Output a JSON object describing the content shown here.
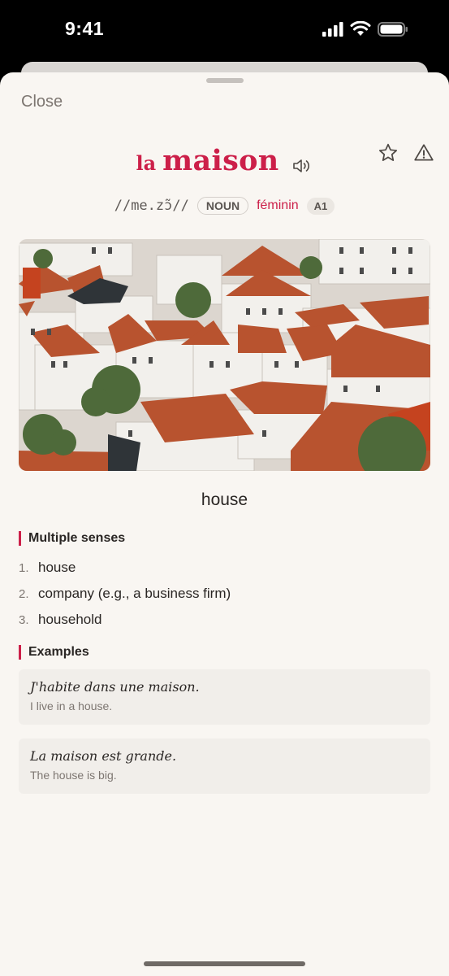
{
  "status_bar": {
    "time": "9:41"
  },
  "sheet": {
    "close_label": "Close"
  },
  "entry": {
    "article": "la",
    "headword": "maison",
    "ipa": "//me.zɔ̃//",
    "part_of_speech": "NOUN",
    "gender": "féminin",
    "level": "A1",
    "translation": "house"
  },
  "senses_section": {
    "title": "Multiple senses",
    "items": [
      {
        "num": "1.",
        "text": "house"
      },
      {
        "num": "2.",
        "text": "company (e.g., a business firm)"
      },
      {
        "num": "3.",
        "text": "household"
      }
    ]
  },
  "examples_section": {
    "title": "Examples",
    "items": [
      {
        "fr": "J'habite dans une maison.",
        "en": "I live in a house."
      },
      {
        "fr": "La maison est grande.",
        "en": "The house is big."
      }
    ]
  },
  "icons": {
    "favorite": "star-icon",
    "report": "warning-icon",
    "audio": "speaker-icon"
  },
  "colors": {
    "accent": "#cc1f49",
    "sheet_background": "#f9f6f2",
    "example_background": "#f1eeea"
  }
}
